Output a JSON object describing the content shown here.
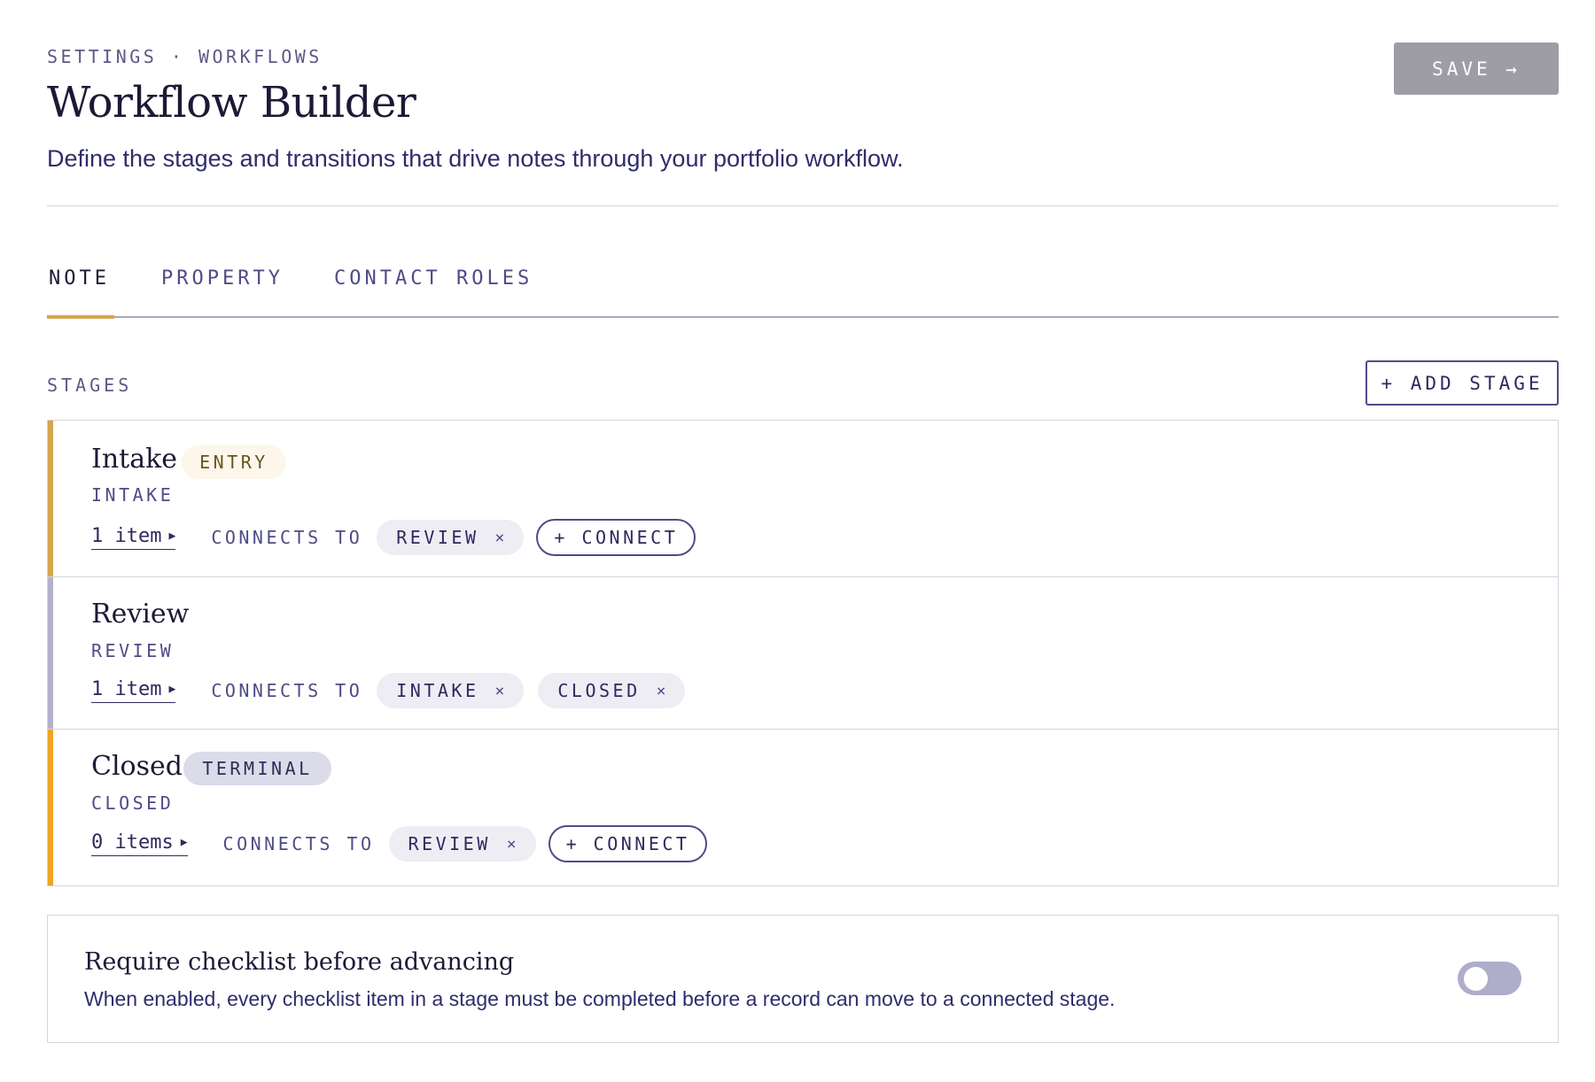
{
  "breadcrumb": "SETTINGS · WORKFLOWS",
  "title": "Workflow Builder",
  "subtitle": "Define the stages and transitions that drive notes through your portfolio workflow.",
  "save_label": "SAVE →",
  "tabs": [
    {
      "label": "NOTE",
      "active": true
    },
    {
      "label": "PROPERTY",
      "active": false
    },
    {
      "label": "CONTACT ROLES",
      "active": false
    }
  ],
  "stages_label": "STAGES",
  "add_stage_label": "+ ADD STAGE",
  "connects_label": "CONNECTS TO",
  "connect_label": "+ CONNECT",
  "remove_glyph": "×",
  "stages": [
    {
      "name": "Intake",
      "key": "INTAKE",
      "badge": "ENTRY",
      "items": "1 item",
      "connections": [
        "REVIEW"
      ],
      "bar_color": "#d6a64d"
    },
    {
      "name": "Review",
      "key": "REVIEW",
      "badge": "",
      "items": "1 item",
      "connections": [
        "INTAKE",
        "CLOSED"
      ],
      "bar_color": "#b3b2cc"
    },
    {
      "name": "Closed",
      "key": "CLOSED",
      "badge": "TERMINAL",
      "items": "0 items",
      "connections": [
        "REVIEW"
      ],
      "bar_color": "#f0a322"
    }
  ],
  "checklist": {
    "title": "Require checklist before advancing",
    "description": "When enabled, every checklist item in a stage must be completed before a record can move to a connected stage.",
    "enabled": false
  }
}
